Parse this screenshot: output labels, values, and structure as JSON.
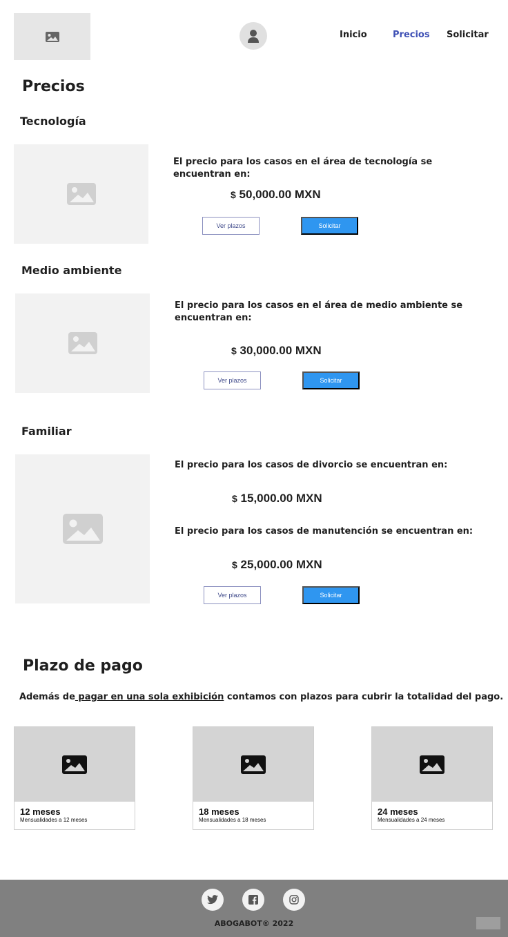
{
  "header": {
    "logo_icon": "image-placeholder-icon",
    "avatar_icon": "user-icon",
    "nav": {
      "inicio": "Inicio",
      "precios": "Precios",
      "solicitar": "Solicitar"
    },
    "active_color": "#3f51b5"
  },
  "page_title": "Precios",
  "sections": {
    "tecnologia": {
      "title": "Tecnología",
      "description": "El precio para los casos en el área de tecnología se encuentran en:",
      "currency": "$",
      "price": "50,000.00 MXN",
      "ver_plazos": "Ver plazos",
      "solicitar": "Solicitar"
    },
    "medio_ambiente": {
      "title": "Medio ambiente",
      "description": "El precio para los casos en el área de medio ambiente se encuentran en:",
      "currency": "$",
      "price": "30,000.00 MXN",
      "ver_plazos": "Ver plazos",
      "solicitar": "Solicitar"
    },
    "familiar": {
      "title": "Familiar",
      "description_1": "El precio para los casos de divorcio se encuentran en:",
      "currency_1": "$",
      "price_1": "15,000.00 MXN",
      "description_2": "El precio para los casos de manutención se encuentran en:",
      "currency_2": "$",
      "price_2": "25,000.00 MXN",
      "ver_plazos": "Ver plazos",
      "solicitar": "Solicitar"
    }
  },
  "plazo": {
    "title": "Plazo de pago",
    "text_before": "Además de",
    "link": " pagar en una sola exhibición",
    "text_after": " contamos con plazos para cubrir la totalidad del pago.",
    "cards": [
      {
        "title": "12 meses",
        "subtitle": "Mensualidades a 12 meses"
      },
      {
        "title": "18 meses",
        "subtitle": "Mensualidades a 18 meses"
      },
      {
        "title": "24 meses",
        "subtitle": "Mensualidades a 24 meses"
      }
    ]
  },
  "footer": {
    "social_icons": [
      "twitter-icon",
      "facebook-icon",
      "instagram-icon"
    ],
    "copyright": "ABOGABOT® 2022"
  },
  "colors": {
    "primary_button": "#2f96f0",
    "footer_bg": "#808080"
  }
}
